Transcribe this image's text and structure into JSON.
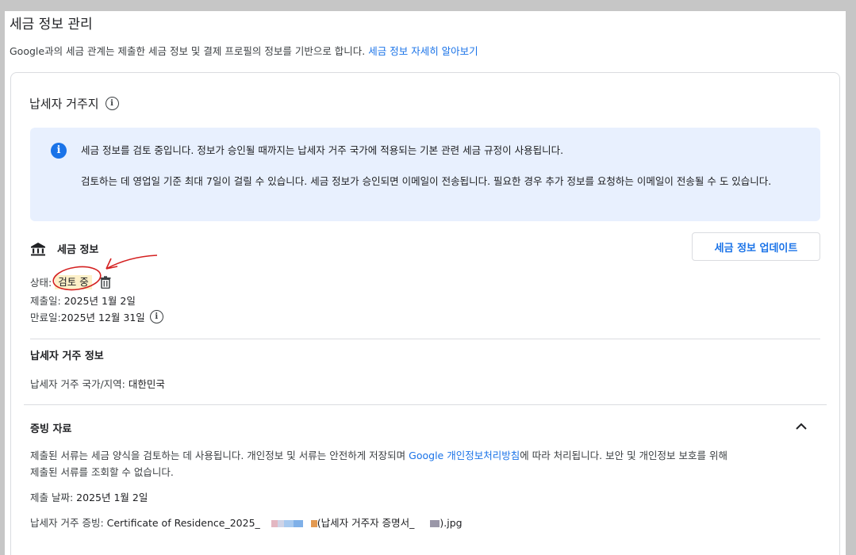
{
  "page": {
    "title": "세금 정보 관리",
    "intro_text": "Google과의 세금 관계는 제출한 세금 정보 및 결제 프로필의 정보를 기반으로 합니다. ",
    "intro_link": "세금 정보 자세히 알아보기"
  },
  "residence": {
    "heading": "납세자 거주지",
    "banner_line1": "세금 정보를 검토 중입니다. 정보가 승인될 때까지는 납세자 거주 국가에 적용되는 기본 관련 세금 규정이 사용됩니다.",
    "banner_line2": "검토하는 데 영업일 기준 최대 7일이 걸릴 수 있습니다. 세금 정보가 승인되면 이메일이 전송됩니다. 필요한 경우 추가 정보를 요청하는 이메일이 전송될 수 도 있습니다."
  },
  "tax_info": {
    "heading": "세금 정보",
    "update_button": "세금 정보 업데이트",
    "status_label": "상태:",
    "status_value": "검토 중",
    "submitted_label": "제출일: ",
    "submitted_value": "2025년 1월 2일",
    "expiry_label": "만료일: ",
    "expiry_value": "2025년 12월 31일"
  },
  "residence_info": {
    "heading": "납세자 거주 정보",
    "country_label": "납세자 거주 국가/지역: ",
    "country_value": "대한민국"
  },
  "documents": {
    "heading": "증빙 자료",
    "desc_part1": "제출된 서류는 세금 양식을 검토하는 데 사용됩니다. 개인정보 및 서류는 안전하게 저장되며 ",
    "desc_link": "Google 개인정보처리방침",
    "desc_part2": "에 따라 처리됩니다. 보안 및 개인정보 보호를 위해",
    "desc_line2": "제출된 서류를 조회할 수 없습니다.",
    "date_label": "제출 날짜: ",
    "date_value": "2025년 1월 2일",
    "proof_label": "납세자 거주 증빙: ",
    "proof_file_part1": "Certificate of Residence_2025_",
    "proof_file_part2": "(납세자 거주자 증명서_",
    "proof_file_part3": ").jpg"
  },
  "colors": {
    "link": "#1a73e8",
    "banner_bg": "#e8f0fe",
    "status_highlight": "#fdf0c8",
    "annotation": "#d42020"
  },
  "icons": {
    "info": "info-circle-icon",
    "bank": "bank-icon",
    "trash": "trash-icon",
    "chevron": "chevron-up-icon"
  }
}
